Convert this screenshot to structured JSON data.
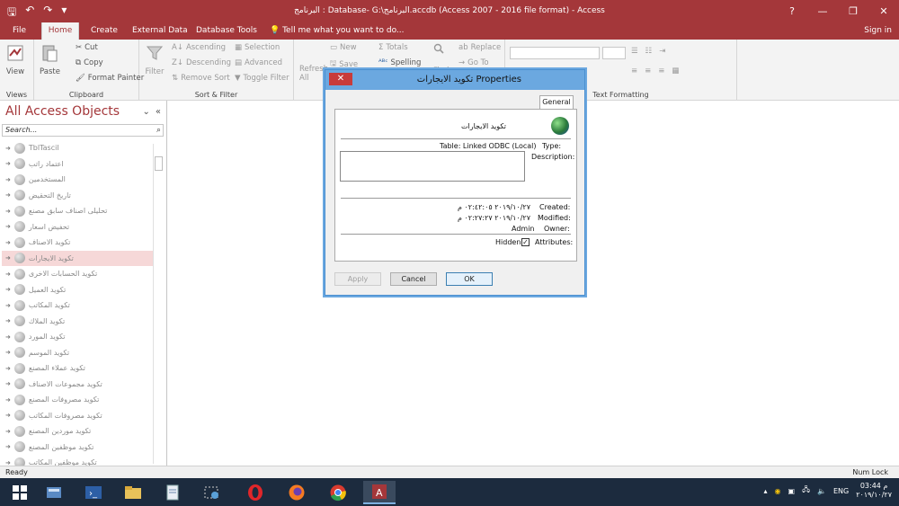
{
  "window": {
    "title": "البرنامج : Database- G:\\البرنامج.accdb (Access 2007 - 2016 file format) - Access",
    "controls": [
      "?",
      "—",
      "❐",
      "✕"
    ]
  },
  "ribbon_tabs": {
    "file": "File",
    "home": "Home",
    "create": "Create",
    "external": "External Data",
    "dbtools": "Database Tools",
    "tellme": "Tell me what you want to do...",
    "signin": "Sign in"
  },
  "ribbon": {
    "views": {
      "view": "View",
      "label": "Views"
    },
    "clipboard": {
      "paste": "Paste",
      "cut": "Cut",
      "copy": "Copy",
      "format_painter": "Format Painter",
      "label": "Clipboard"
    },
    "sort_filter": {
      "filter": "Filter",
      "ascending": "Ascending",
      "descending": "Descending",
      "remove_sort": "Remove Sort",
      "selection": "Selection",
      "advanced": "Advanced",
      "toggle_filter": "Toggle Filter",
      "label": "Sort & Filter"
    },
    "records": {
      "refresh": "Refresh",
      "all": "All",
      "new": "New",
      "save": "Save",
      "totals": "Totals",
      "spelling": "Spelling"
    },
    "find": {
      "find": "Find",
      "replace": "Replace",
      "goto": "Go To"
    },
    "text_formatting": {
      "label": "Text Formatting"
    }
  },
  "nav": {
    "header": "All Access Objects",
    "search_placeholder": "Search...",
    "items": [
      "TblTascil",
      "اعتماد راتب",
      "المستخدمين",
      "تاريخ التحقيض",
      "تحليلى اصناف سابق مصنع",
      "تحفيض اسعار",
      "تكويد الاصناف",
      "تكويد الايجارات",
      "تكويد الحسابات الاخرى",
      "تكويد العميل",
      "تكويد المكاتب",
      "تكويد الملاك",
      "تكويد المورد",
      "تكويد الموسم",
      "تكويد عملاء المصنع",
      "تكويد مجموعات الاصناف",
      "تكويد مصروفات المصنع",
      "تكويد مصروفات المكاتب",
      "تكويد موردين المصنع",
      "تكويد موظفين المصنع",
      "تكويد موظفين المكاتب"
    ],
    "selected_index": 7
  },
  "dialog": {
    "title": "تكويد الايجارات Properties",
    "tab": "General",
    "object_name": "تكويد الايجارات",
    "type_label": "Type:",
    "type_value": "Table: Linked ODBC (Local)",
    "description_label": "Description:",
    "description_value": "",
    "created_label": "Created:",
    "created_value": "٢٠١٩/١٠/٢٧ ٠٢:٤٢:٠٥ م",
    "modified_label": "Modified:",
    "modified_value": "٢٠١٩/١٠/٢٧ ٠٢:٢٧:٢٧ م",
    "owner_label": "Owner:",
    "owner_value": "Admin",
    "attributes_label": "Attributes:",
    "hidden_label": "Hidden",
    "hidden_checked": true,
    "apply": "Apply",
    "cancel": "Cancel",
    "ok": "OK"
  },
  "status": {
    "left": "Ready",
    "right": "Num Lock"
  },
  "taskbar": {
    "language": "ENG",
    "time": "03:44 م",
    "date": "٢٠١٩/١٠/٢٧"
  },
  "colors": {
    "access_accent": "#a4373a",
    "dialog_title": "#6ba8e0",
    "taskbar": "#1c2b3e"
  }
}
